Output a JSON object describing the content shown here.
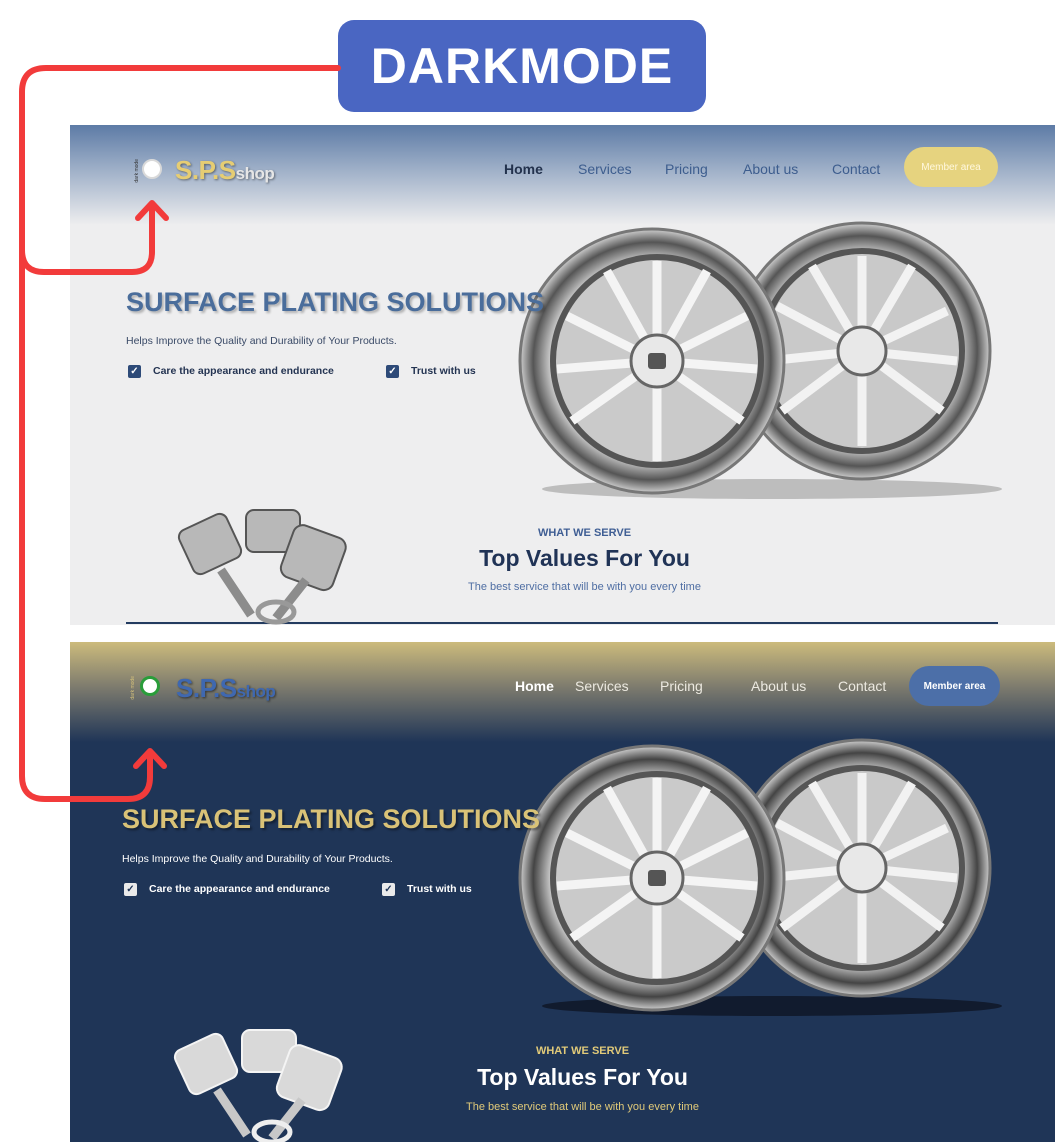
{
  "annotation": {
    "badge_label": "DARKMODE",
    "arrow_color": "#f23b3b",
    "badge_color": "#4a66c2"
  },
  "site": {
    "toggle_label": "dark mode",
    "logo_main": "S.P.S",
    "logo_sub": "shop",
    "nav": [
      "Home",
      "Services",
      "Pricing",
      "About us",
      "Contact"
    ],
    "member_button": "Member area",
    "hero": {
      "title": "SURFACE PLATING SOLUTIONS",
      "subtitle": "Helps Improve the Quality and Durability of Your Products.",
      "checks": [
        "Care the appearance and endurance",
        "Trust with us"
      ]
    },
    "serve": {
      "kicker": "WHAT WE SERVE",
      "title": "Top Values For You",
      "description": "The best service that will be with you every time"
    }
  },
  "themes": {
    "light": {
      "background": "#eeeeef",
      "header_top": "#5d7ba6",
      "accent": "#e6d37f",
      "title_color": "#4a6d9b"
    },
    "dark": {
      "background": "#1f3557",
      "header_top": "#ccbb7c",
      "accent": "#4c6fa8",
      "title_color": "#d9c277"
    }
  },
  "icons": [
    "checkbox-checked-icon",
    "toggle-switch-icon",
    "wheel-rim-image",
    "pistons-image",
    "arrow-up-icon"
  ]
}
